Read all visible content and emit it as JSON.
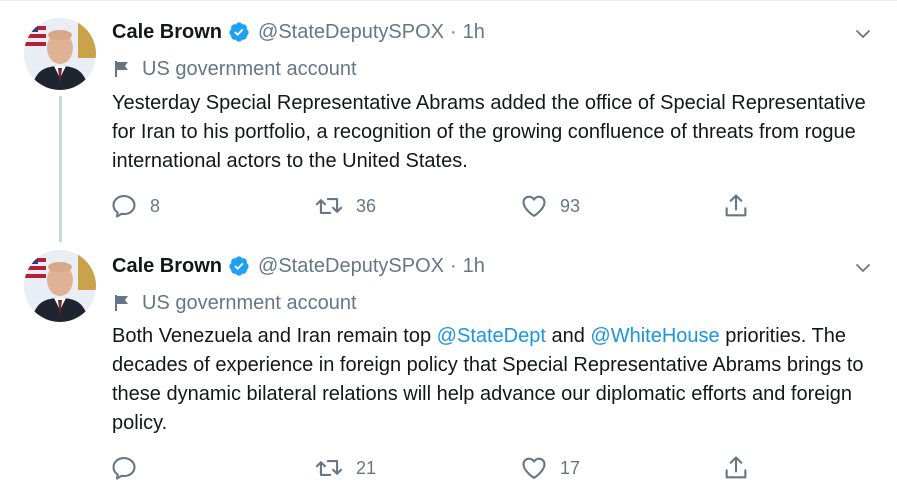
{
  "tweets": [
    {
      "author": {
        "name": "Cale Brown",
        "handle": "@StateDeputySPOX",
        "time": "1h"
      },
      "label": "US government account",
      "text": "Yesterday Special Representative Abrams added the office of Special Representative for Iran to his portfolio, a recognition of the growing confluence of threats from rogue international actors to the United States.",
      "replies": "8",
      "retweets": "36",
      "likes": "93"
    },
    {
      "author": {
        "name": "Cale Brown",
        "handle": "@StateDeputySPOX",
        "time": "1h"
      },
      "label": "US government account",
      "text_parts": {
        "t1": "Both Venezuela and Iran remain top ",
        "m1": "@StateDept",
        "t2": " and ",
        "m2": "@WhiteHouse",
        "t3": " priorities. The decades of experience in foreign policy that Special Representative Abrams brings to these dynamic bilateral relations will help advance our diplomatic efforts and foreign policy."
      },
      "replies": "",
      "retweets": "21",
      "likes": "17"
    }
  ],
  "colors": {
    "accent": "#1da1f2",
    "link": "#1b95e0",
    "muted": "#657786",
    "thread_line": "#ccd6dd"
  },
  "icons": [
    "verified-badge-icon",
    "chevron-down-icon",
    "flag-icon",
    "reply-icon",
    "retweet-icon",
    "like-icon",
    "share-icon"
  ]
}
